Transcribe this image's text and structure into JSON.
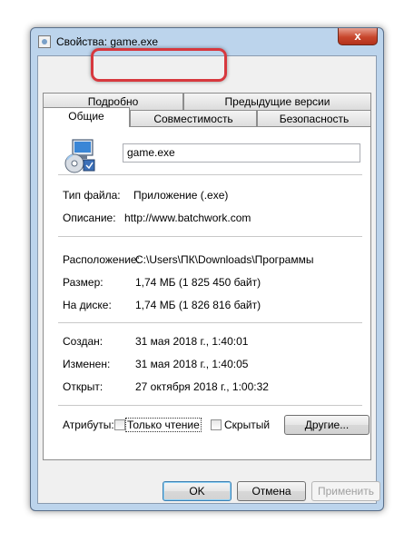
{
  "window": {
    "title": "Свойства: game.exe",
    "close_symbol": "x",
    "title_icon": "properties-window-icon"
  },
  "tabs": {
    "row1": [
      "Подробно",
      "Предыдущие версии"
    ],
    "row2": [
      "Общие",
      "Совместимость",
      "Безопасность"
    ],
    "active": "Общие",
    "highlighted": "Совместимость"
  },
  "file": {
    "icon": "exe-application-icon",
    "name": "game.exe"
  },
  "details": {
    "type_label": "Тип файла:",
    "type_value": "Приложение (.exe)",
    "description_label": "Описание:",
    "description_value": "http://www.batchwork.com",
    "location_label": "Расположение:",
    "location_value": "C:\\Users\\ПК\\Downloads\\Программы",
    "size_label": "Размер:",
    "size_value": "1,74 МБ (1 825 450 байт)",
    "disk_label": "На диске:",
    "disk_value": "1,74 МБ (1 826 816 байт)",
    "created_label": "Создан:",
    "created_value": "31 мая 2018 г., 1:40:01",
    "modified_label": "Изменен:",
    "modified_value": "31 мая 2018 г., 1:40:05",
    "opened_label": "Открыт:",
    "opened_value": "27 октября 2018 г., 1:00:32"
  },
  "attributes": {
    "label": "Атрибуты:",
    "readonly_label": "Только чтение",
    "readonly_checked": false,
    "hidden_label": "Скрытый",
    "hidden_checked": false,
    "other_button": "Другие..."
  },
  "buttons": {
    "ok": "OK",
    "cancel": "Отмена",
    "apply": "Применить"
  },
  "colors": {
    "highlight": "#d7383e",
    "close_button": "#c8462c",
    "frame": "#bcd4ec"
  }
}
